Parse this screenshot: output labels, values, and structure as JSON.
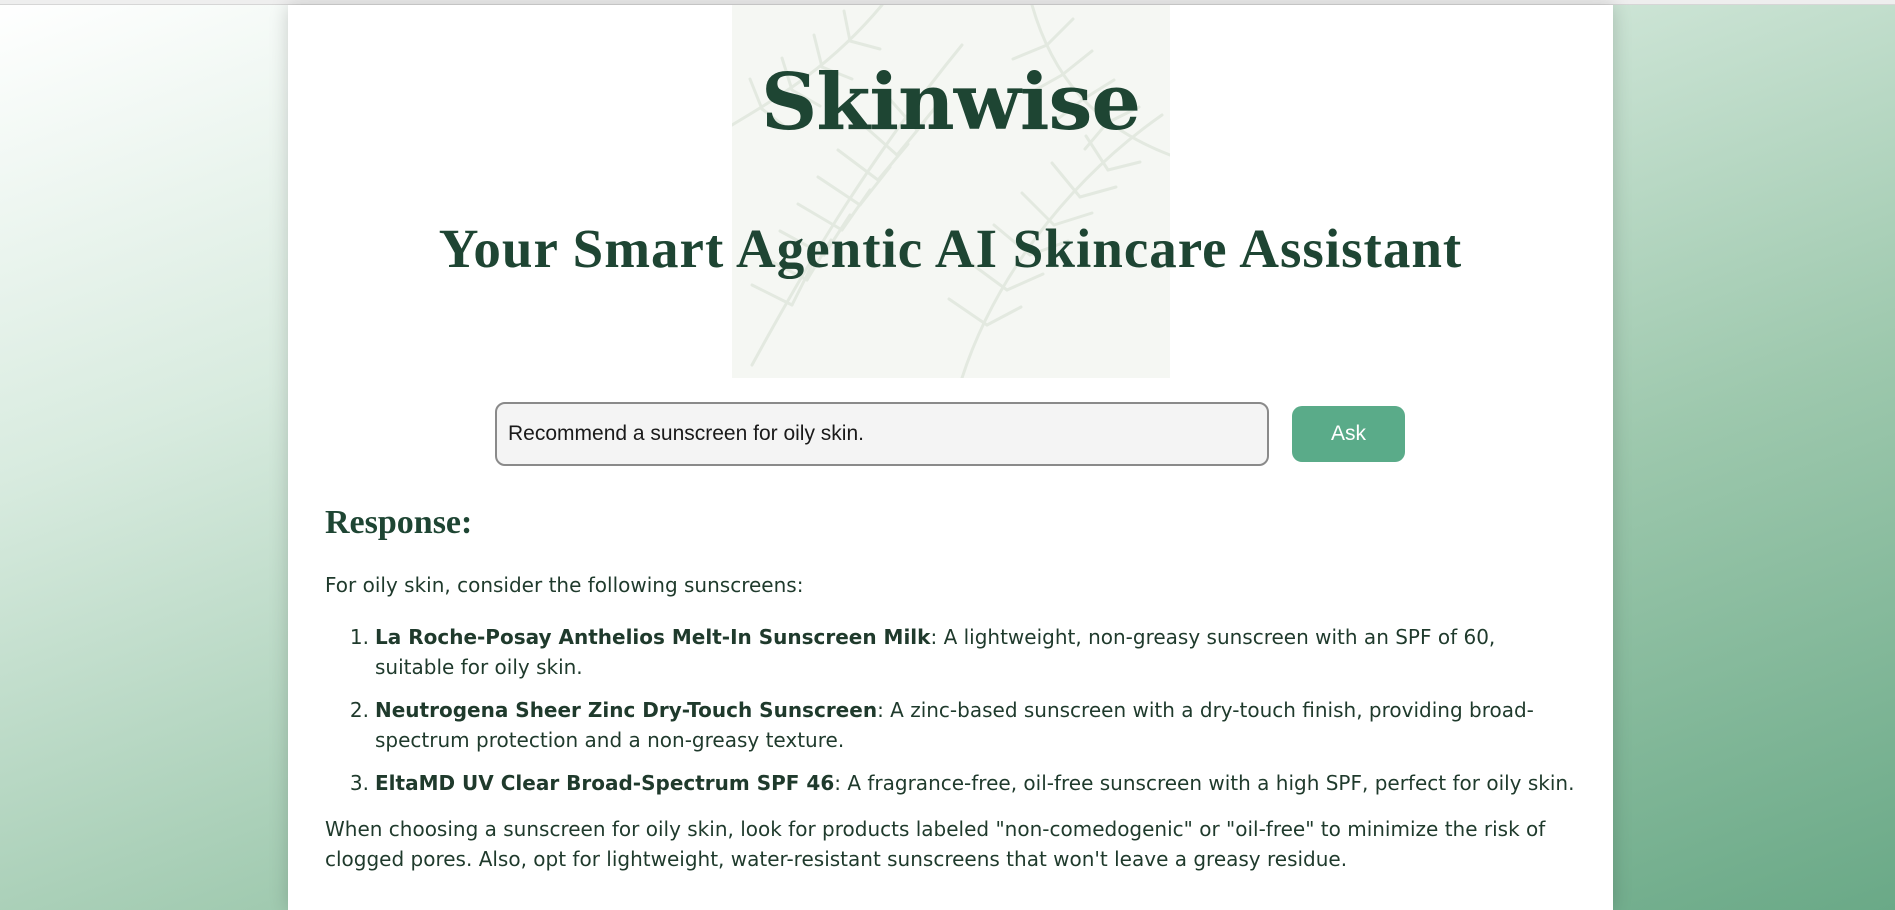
{
  "app": {
    "title": "Skinwise",
    "tagline": "Your Smart Agentic AI Skincare Assistant"
  },
  "search": {
    "value": "Recommend a sunscreen for oily skin.",
    "button_label": "Ask"
  },
  "response": {
    "heading": "Response:",
    "intro": "For oily skin, consider the following sunscreens:",
    "items": [
      {
        "number": "1.",
        "name": "La Roche-Posay Anthelios Melt-In Sunscreen Milk",
        "description": ": A lightweight, non-greasy sunscreen with an SPF of 60, suitable for oily skin."
      },
      {
        "number": "2.",
        "name": "Neutrogena Sheer Zinc Dry-Touch Sunscreen",
        "description": ": A zinc-based sunscreen with a dry-touch finish, providing broad-spectrum protection and a non-greasy texture."
      },
      {
        "number": "3.",
        "name": "EltaMD UV Clear Broad-Spectrum SPF 46",
        "description": ": A fragrance-free, oil-free sunscreen with a high SPF, perfect for oily skin."
      }
    ],
    "closing": "When choosing a sunscreen for oily skin, look for products labeled \"non-comedogenic\" or \"oil-free\" to minimize the risk of clogged pores. Also, opt for lightweight, water-resistant sunscreens that won't leave a greasy residue."
  },
  "colors": {
    "brand_text": "#1e4533",
    "accent_button": "#5aab89",
    "background_gradient_end": "#6aa987"
  },
  "icons": {
    "hero_pattern": "palm-leaf-pattern"
  }
}
